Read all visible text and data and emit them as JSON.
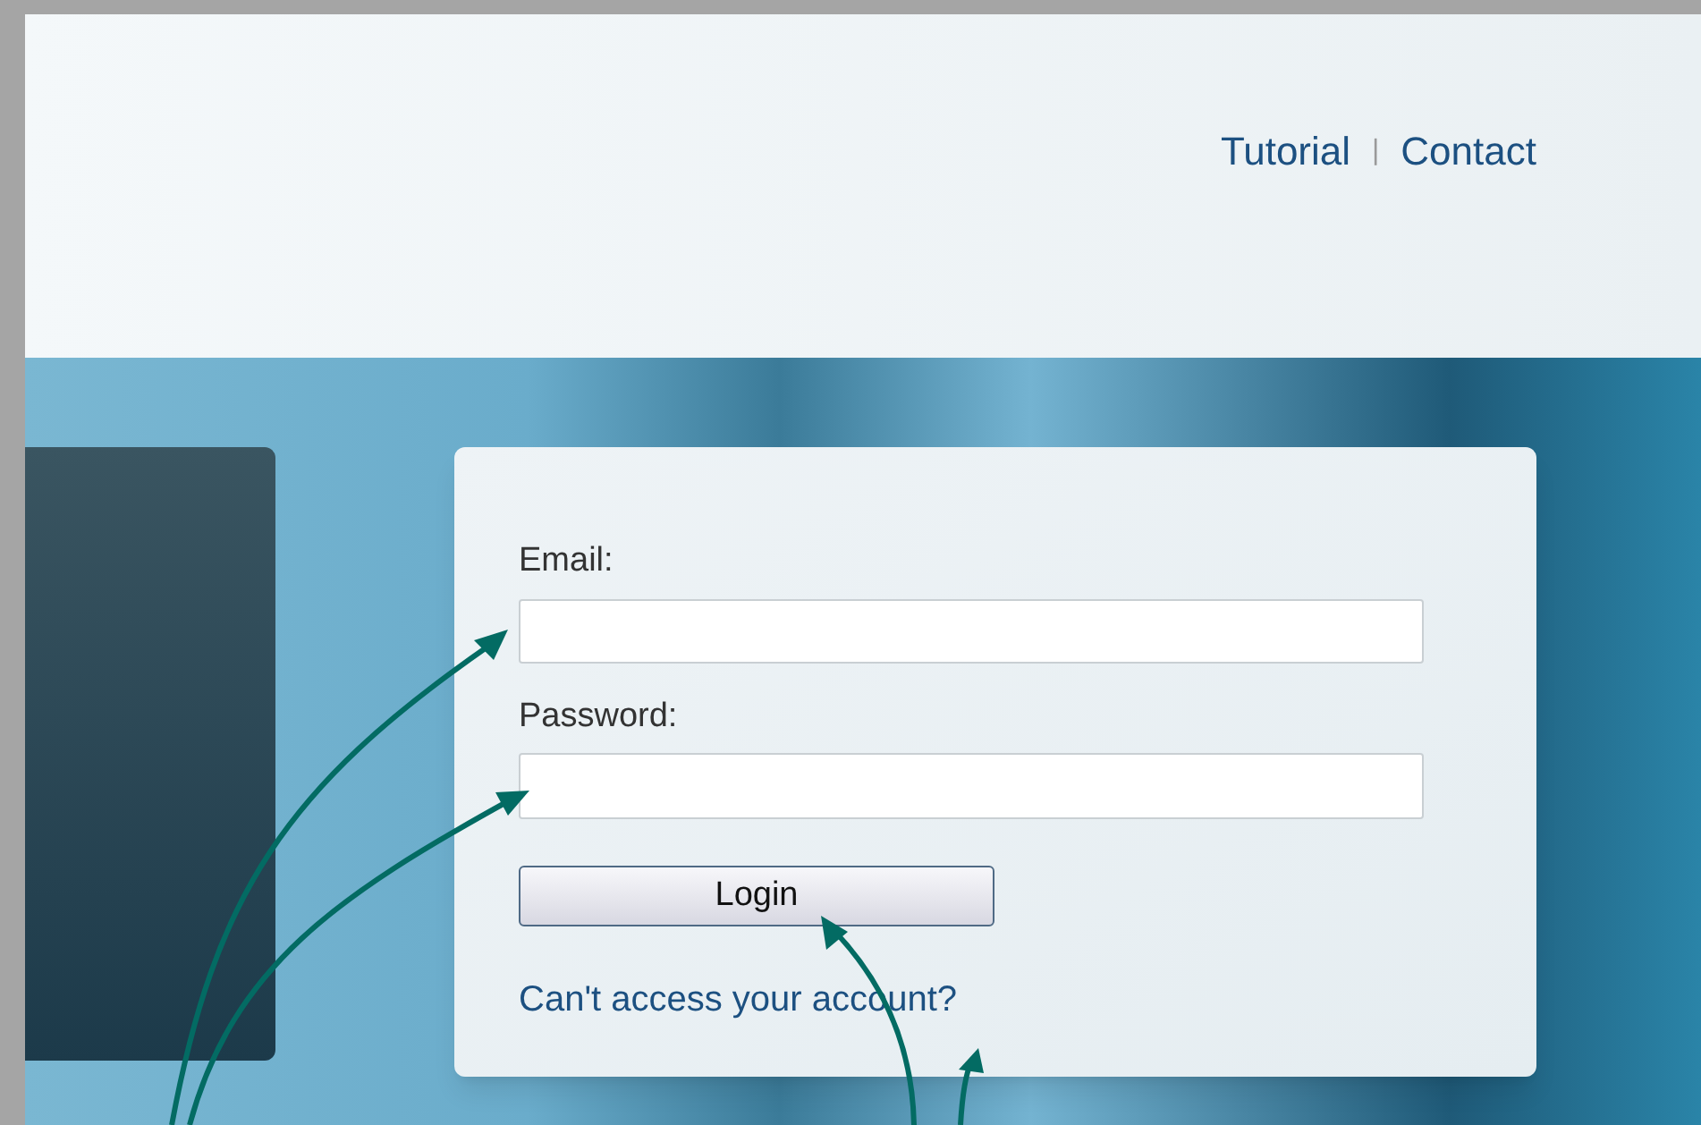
{
  "nav": [
    {
      "label": "Tutorial"
    },
    {
      "label": "Contact"
    }
  ],
  "separator": "|",
  "login_form": {
    "email_label": "Email:",
    "password_label": "Password:",
    "button": "Login",
    "help_link": "Can't access your account?"
  }
}
